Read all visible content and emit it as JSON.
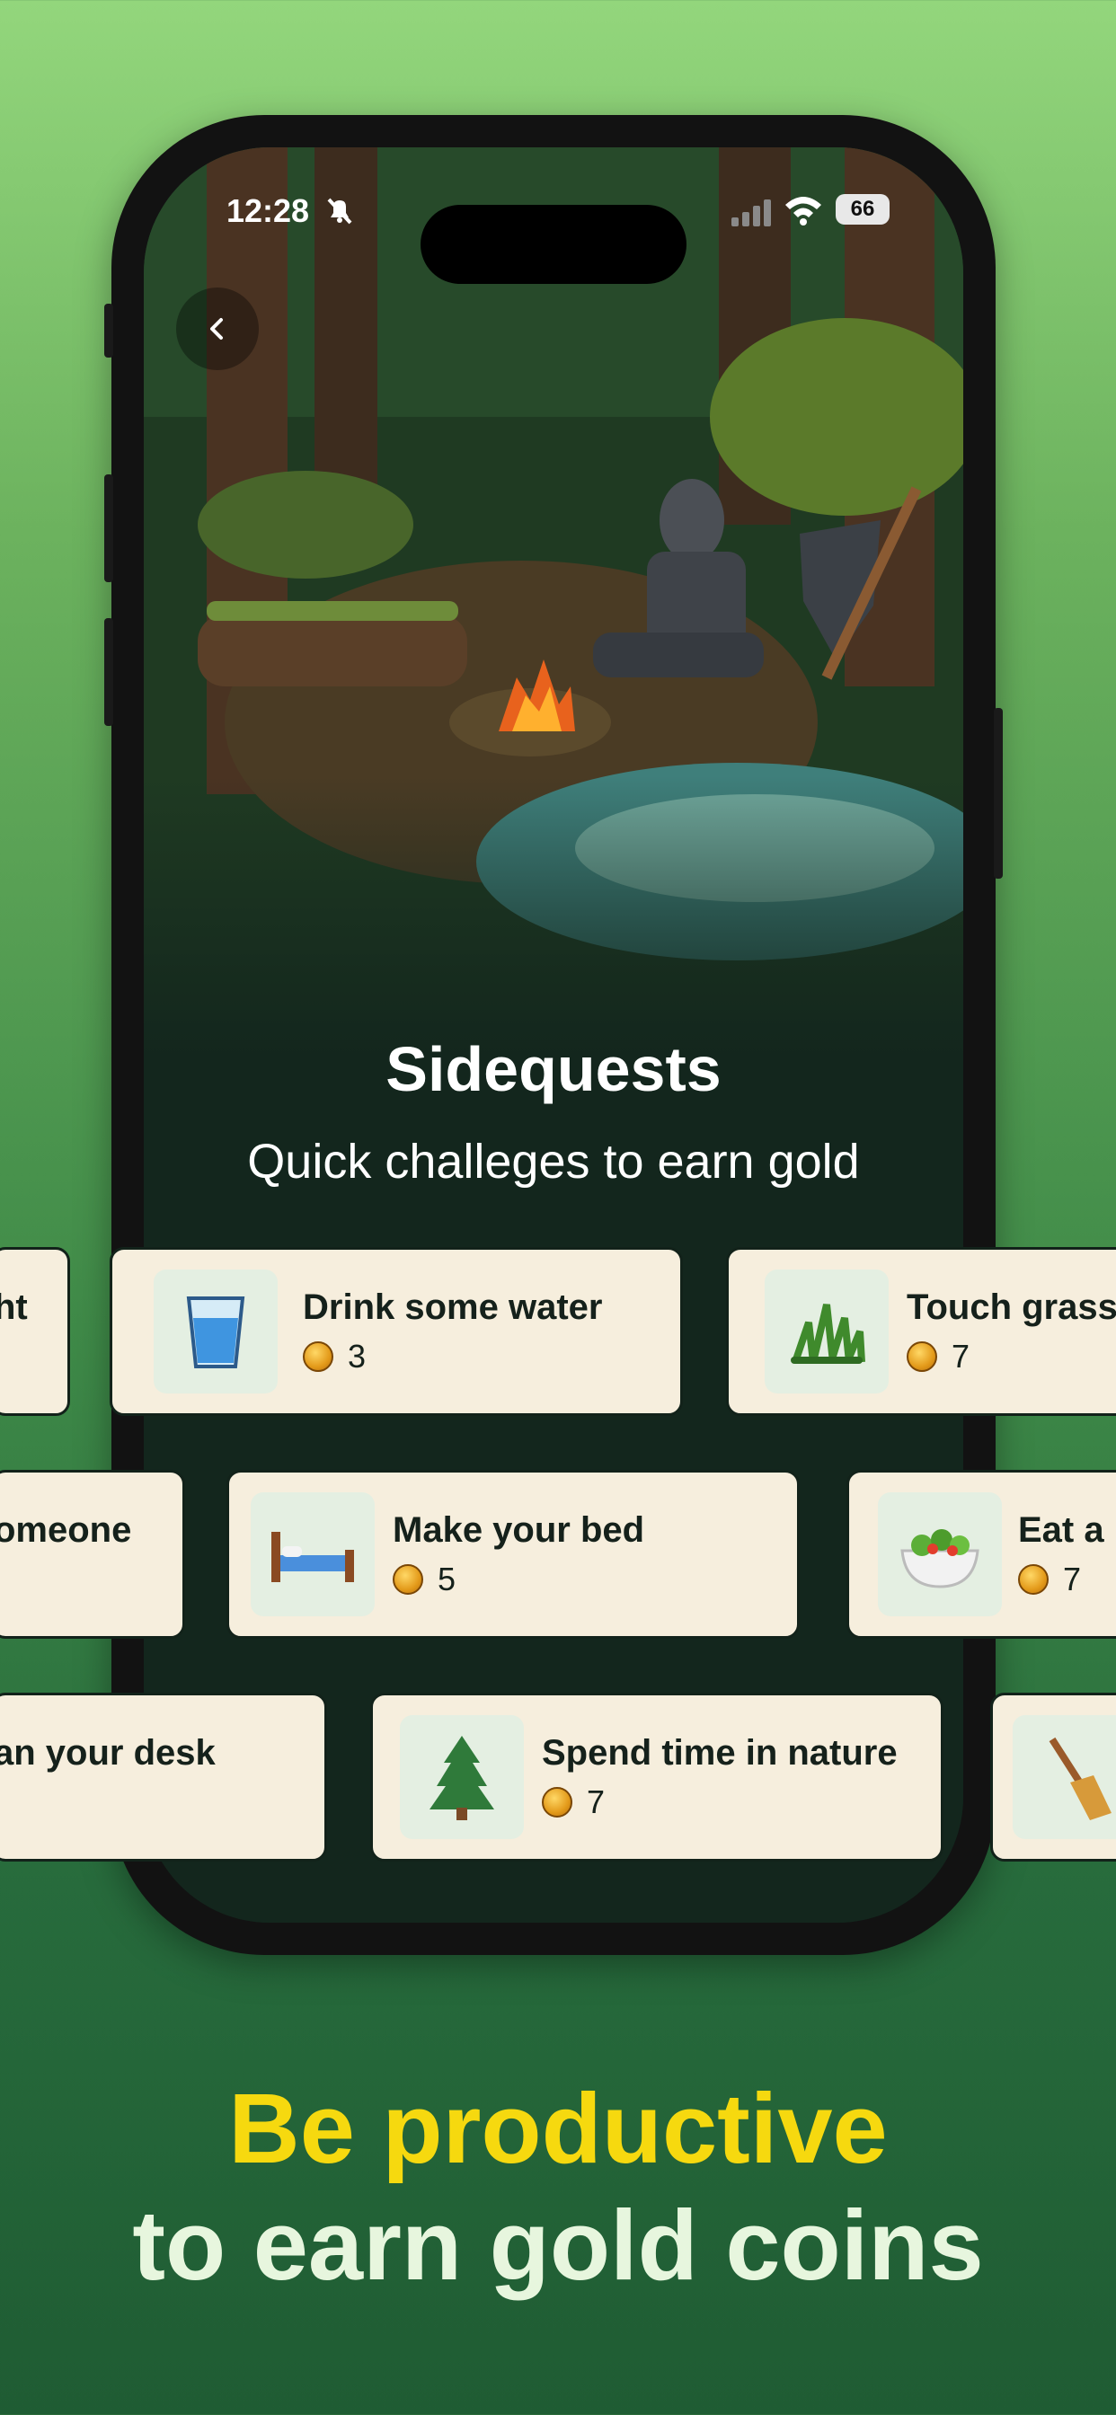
{
  "status_bar": {
    "time": "12:28",
    "battery": "66"
  },
  "header": {
    "title": "Sidequests",
    "subtitle": "Quick challeges to earn gold"
  },
  "rows": [
    [
      {
        "title": "ht",
        "value": ""
      },
      {
        "title": "Drink some water",
        "value": "3",
        "icon": "water-glass-icon"
      },
      {
        "title": "Touch grass",
        "value": "7",
        "icon": "grass-icon"
      }
    ],
    [
      {
        "title": "omeone",
        "value": ""
      },
      {
        "title": "Make your bed",
        "value": "5",
        "icon": "bed-icon"
      },
      {
        "title": "Eat a l",
        "value": "7",
        "icon": "salad-icon"
      }
    ],
    [
      {
        "title": "an your desk",
        "value": ""
      },
      {
        "title": "Spend time in nature",
        "value": "7",
        "icon": "tree-icon"
      },
      {
        "title": "",
        "value": "",
        "icon": "broom-icon"
      }
    ]
  ],
  "tagline": {
    "line1": "Be productive",
    "line2": "to earn gold coins"
  },
  "colors": {
    "accent": "#f6d90f",
    "card_bg": "#f6eedd",
    "screen_bg": "#13261d"
  }
}
